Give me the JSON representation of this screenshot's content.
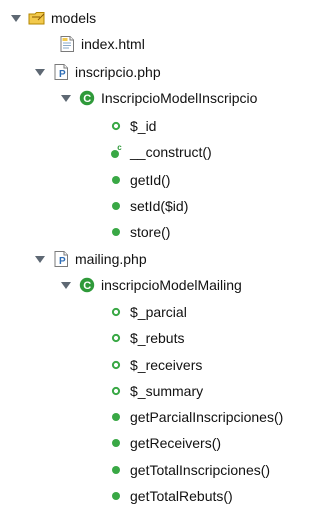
{
  "tree": {
    "models": {
      "label": "models"
    },
    "index_html": {
      "label": "index.html"
    },
    "inscripcio_php": {
      "label": "inscripcio.php"
    },
    "inscripcio_class": {
      "label": "InscripcioModelInscripcio"
    },
    "inscripcio_members": [
      {
        "label": "$_id"
      },
      {
        "label": "__construct()"
      },
      {
        "label": "getId()"
      },
      {
        "label": "setId($id)"
      },
      {
        "label": "store()"
      }
    ],
    "mailing_php": {
      "label": "mailing.php"
    },
    "mailing_class": {
      "label": "inscripcioModelMailing"
    },
    "mailing_members": [
      {
        "label": "$_parcial"
      },
      {
        "label": "$_rebuts"
      },
      {
        "label": "$_receivers"
      },
      {
        "label": "$_summary"
      },
      {
        "label": "getParcialInscripciones()"
      },
      {
        "label": "getReceivers()"
      },
      {
        "label": "getTotalInscripciones()"
      },
      {
        "label": "getTotalRebuts()"
      }
    ]
  },
  "colors": {
    "method_green": "#39a845",
    "class_green": "#2f9a3a",
    "folder_yellow": "#f2c94c",
    "php_blue": "#2f6db5",
    "twisty_gray": "#5e6873"
  }
}
